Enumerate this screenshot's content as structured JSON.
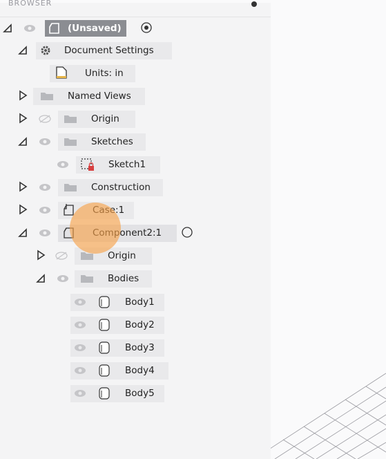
{
  "browser": {
    "header_title": "BROWSER",
    "root": {
      "label": "(Unsaved)"
    },
    "items": [
      {
        "label": "Document Settings"
      },
      {
        "label": "Units: in"
      },
      {
        "label": "Named Views"
      },
      {
        "label": "Origin"
      },
      {
        "label": "Sketches"
      },
      {
        "label": "Sketch1"
      },
      {
        "label": "Construction"
      },
      {
        "label": "Case:1"
      },
      {
        "label": "Component2:1"
      },
      {
        "label": "Origin"
      },
      {
        "label": "Bodies"
      },
      {
        "label": "Body1"
      },
      {
        "label": "Body2"
      },
      {
        "label": "Body3"
      },
      {
        "label": "Body4"
      },
      {
        "label": "Body5"
      }
    ]
  },
  "colors": {
    "panel": "#f4f4f5",
    "label_bg": "#e9e9eb",
    "root_bg": "#8b8d92",
    "click_highlight": "#f7a046",
    "sketch_lock": "#d84040",
    "units_bar": "#e8b64a"
  },
  "icons": [
    "eye-icon",
    "eye-hidden-icon",
    "folder-icon",
    "gear-icon",
    "document-icon",
    "sketch-icon",
    "component-icon",
    "body-icon",
    "radio-icon",
    "expand-arrow-icon",
    "collapse-arrow-icon"
  ]
}
